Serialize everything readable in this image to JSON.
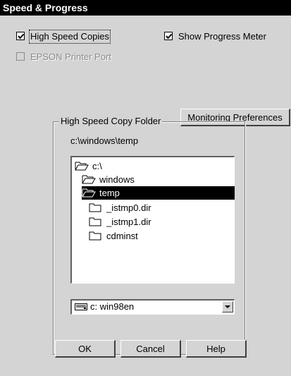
{
  "window": {
    "title": "Speed & Progress"
  },
  "options": {
    "high_speed_copies": {
      "label": "High Speed Copies",
      "checked": true
    },
    "show_progress_meter": {
      "label": "Show Progress Meter",
      "checked": true
    },
    "epson_printer_port": {
      "label": "EPSON Printer Port",
      "checked": false,
      "disabled": true
    }
  },
  "buttons": {
    "monitoring_preferences": "Monitoring Preferences",
    "ok": "OK",
    "cancel": "Cancel",
    "help": "Help"
  },
  "copy_folder": {
    "group_title": "High Speed Copy Folder",
    "current_path": "c:\\windows\\temp",
    "tree": [
      "c:\\",
      "windows",
      "temp",
      "_istmp0.dir",
      "_istmp1.dir",
      "cdminst"
    ],
    "selected": "temp"
  },
  "drive": {
    "value": "c:  win98en",
    "icon": "drive-icon"
  },
  "colors": {
    "dialog_bg": "#d4d4d4",
    "title_bg": "#000000",
    "selection_bg": "#000000"
  }
}
